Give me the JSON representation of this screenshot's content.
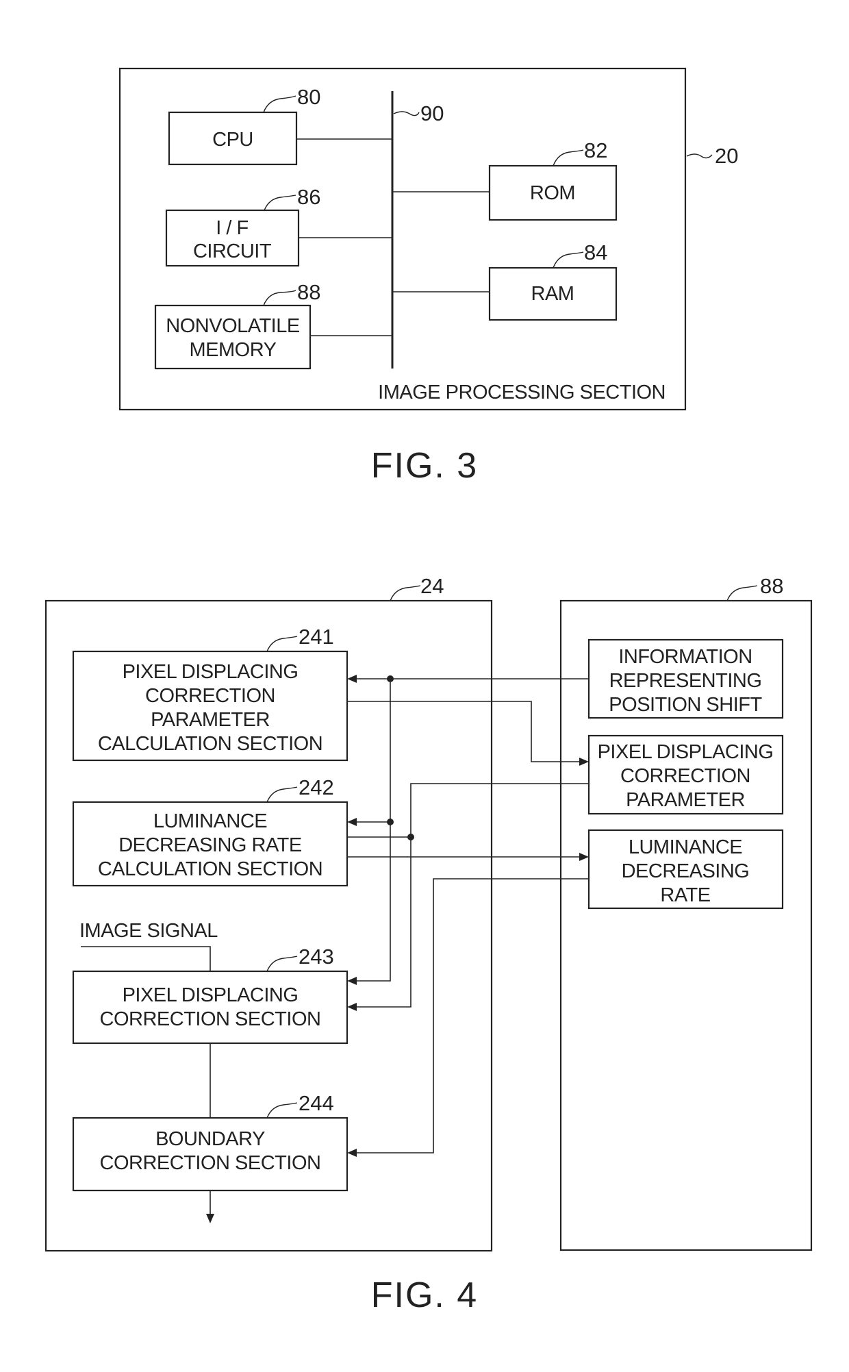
{
  "fig3": {
    "caption": "FIG. 3",
    "section_label": "IMAGE PROCESSING SECTION",
    "outer_ref": "20",
    "bus_ref": "90",
    "blocks": {
      "cpu": {
        "ref": "80",
        "lines": [
          "CPU"
        ]
      },
      "if_circuit": {
        "ref": "86",
        "lines": [
          "I / F",
          "CIRCUIT"
        ]
      },
      "nonvolatile": {
        "ref": "88",
        "lines": [
          "NONVOLATILE",
          "MEMORY"
        ]
      },
      "rom": {
        "ref": "82",
        "lines": [
          "ROM"
        ]
      },
      "ram": {
        "ref": "84",
        "lines": [
          "RAM"
        ]
      }
    }
  },
  "fig4": {
    "caption": "FIG. 4",
    "left_ref": "24",
    "right_ref": "88",
    "image_signal_label": "IMAGE SIGNAL",
    "blocks": {
      "b241": {
        "ref": "241",
        "lines": [
          "PIXEL DISPLACING",
          "CORRECTION",
          "PARAMETER",
          "CALCULATION SECTION"
        ]
      },
      "b242": {
        "ref": "242",
        "lines": [
          "LUMINANCE",
          "DECREASING RATE",
          "CALCULATION SECTION"
        ]
      },
      "b243": {
        "ref": "243",
        "lines": [
          "PIXEL DISPLACING",
          "CORRECTION SECTION"
        ]
      },
      "b244": {
        "ref": "244",
        "lines": [
          "BOUNDARY",
          "CORRECTION SECTION"
        ]
      },
      "info": {
        "lines": [
          "INFORMATION",
          "REPRESENTING",
          "POSITION SHIFT"
        ]
      },
      "param": {
        "lines": [
          "PIXEL DISPLACING",
          "CORRECTION",
          "PARAMETER"
        ]
      },
      "rate": {
        "lines": [
          "LUMINANCE",
          "DECREASING",
          "RATE"
        ]
      }
    }
  }
}
